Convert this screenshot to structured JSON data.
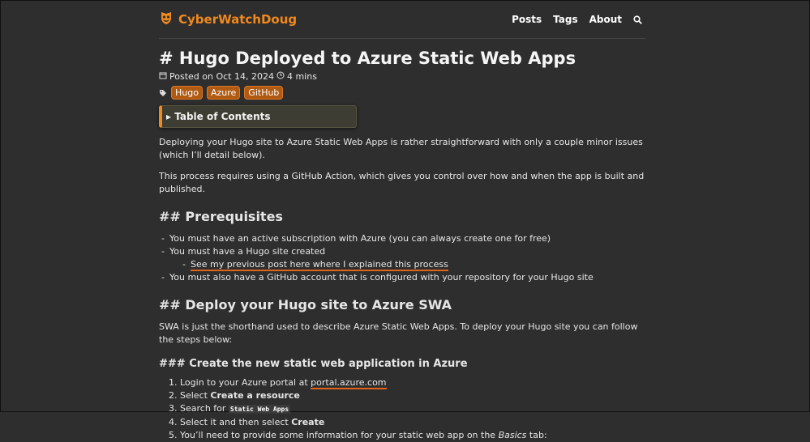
{
  "site": {
    "name": "CyberWatchDoug"
  },
  "nav": {
    "items": [
      "Posts",
      "Tags",
      "About"
    ]
  },
  "post": {
    "title": "# Hugo Deployed to Azure Static Web Apps",
    "date_text": "Posted on Oct 14, 2024",
    "read_time": "4 mins",
    "tags": [
      "Hugo",
      "Azure",
      "GitHub"
    ],
    "toc_label": "▸ Table of Contents"
  },
  "content": {
    "intro1": "Deploying your Hugo site to Azure Static Web Apps is rather straightforward with only a couple minor issues (which I’ll detail below).",
    "intro2": "This process requires using a GitHub Action, which gives you control over how and when the app is built and published.",
    "h_prereq": "## Prerequisites",
    "prereq": [
      "You must have an active subscription with Azure (you can always create one for free)",
      "You must have a Hugo site created",
      "See my previous post here where I explained this process",
      "You must also have a GitHub account that is configured with your repository for your Hugo site"
    ],
    "h_deploy": "## Deploy your Hugo site to Azure SWA",
    "deploy_p": "SWA is just the shorthand used to describe Azure Static Web Apps. To deploy your Hugo site you can follow the steps below:",
    "h_create": "### Create the new static web application in Azure",
    "steps": {
      "s1_pre": "Login to your Azure portal at ",
      "s1_link": "portal.azure.com",
      "s2_pre": "Select ",
      "s2_bold": "Create a resource",
      "s3_pre": "Search for ",
      "s3_code": "Static Web Apps",
      "s4_pre": "Select it and then select ",
      "s4_bold": "Create",
      "s5_pre": "You’ll need to provide some information for your static web app on the ",
      "s5_em": "Basics",
      "s5_post": " tab:"
    }
  }
}
